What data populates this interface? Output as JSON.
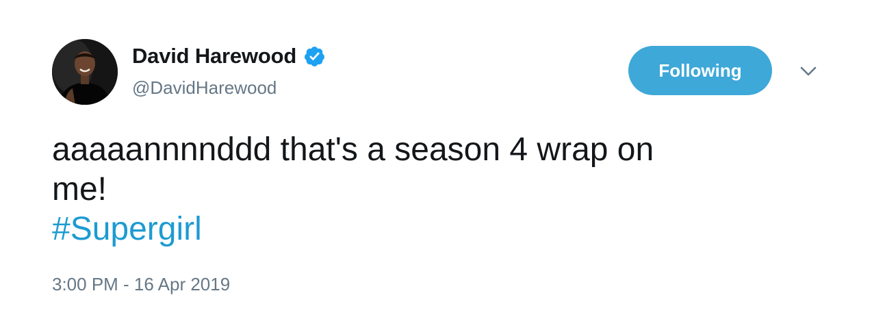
{
  "user": {
    "display_name": "David Harewood",
    "handle": "@DavidHarewood",
    "verified_icon": "verified-badge-icon"
  },
  "actions": {
    "follow_label": "Following",
    "menu_icon": "chevron-down-icon"
  },
  "tweet": {
    "text_line_1": "aaaaannnnddd that's a season 4 wrap on",
    "text_line_2": "me!",
    "hashtag": "#Supergirl",
    "timestamp": "3:00 PM - 16 Apr 2019"
  },
  "colors": {
    "follow_button_bg": "#3ea8d8",
    "hashtag": "#1d9bd1",
    "verified": "#1da1f2",
    "secondary_text": "#657786",
    "primary_text": "#14171a"
  }
}
